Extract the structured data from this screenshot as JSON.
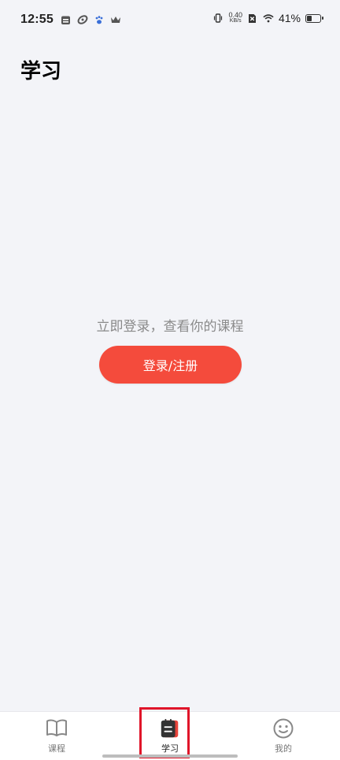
{
  "status_bar": {
    "time": "12:55",
    "speed_value": "0.40",
    "speed_unit": "KB/s",
    "battery_percent": "41%",
    "battery_level": 0.41,
    "icons": [
      "calendar-icon",
      "link-icon",
      "paw-icon",
      "crown-icon",
      "vibrate-icon",
      "sim-icon",
      "wifi-icon",
      "battery-icon"
    ]
  },
  "page": {
    "title": "学习"
  },
  "empty_state": {
    "message": "立即登录，查看你的课程",
    "login_label": "登录/注册"
  },
  "tab_bar": {
    "active": "study",
    "tabs": [
      {
        "id": "courses",
        "label": "课程",
        "icon": "book-icon"
      },
      {
        "id": "study",
        "label": "学习",
        "icon": "notebook-icon"
      },
      {
        "id": "me",
        "label": "我的",
        "icon": "smiley-icon"
      }
    ]
  },
  "colors": {
    "background": "#f3f4f8",
    "accent": "#f44b3c",
    "highlight": "#e0152a"
  }
}
